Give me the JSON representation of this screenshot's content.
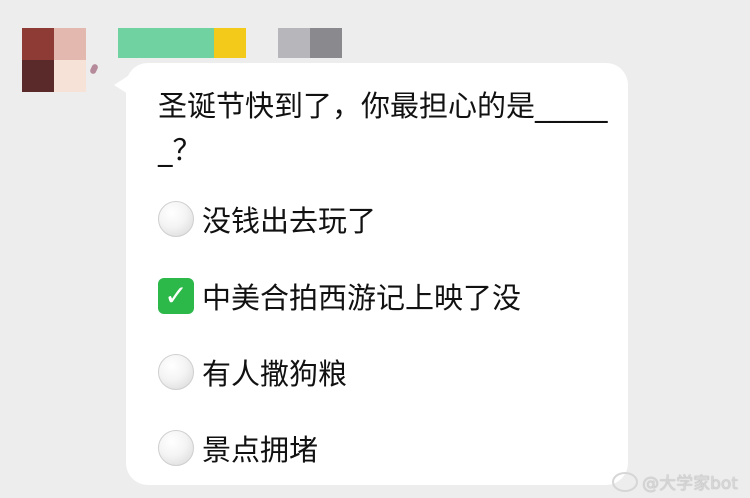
{
  "question": {
    "text": "圣诞节快到了，你最担心的是______？"
  },
  "options": [
    {
      "label": "没钱出去玩了",
      "selected": false,
      "icon": "radio-empty-icon"
    },
    {
      "label": "中美合拍西游记上映了没",
      "selected": true,
      "icon": "check-box-icon"
    },
    {
      "label": "有人撒狗粮",
      "selected": false,
      "icon": "radio-empty-icon"
    },
    {
      "label": "景点拥堵",
      "selected": false,
      "icon": "radio-empty-icon"
    }
  ],
  "check_glyph": "✓",
  "watermark": {
    "text": "@大学家bot"
  },
  "colors": {
    "background": "#ededed",
    "bubble": "#ffffff",
    "check": "#2db84a",
    "text": "#111111"
  }
}
